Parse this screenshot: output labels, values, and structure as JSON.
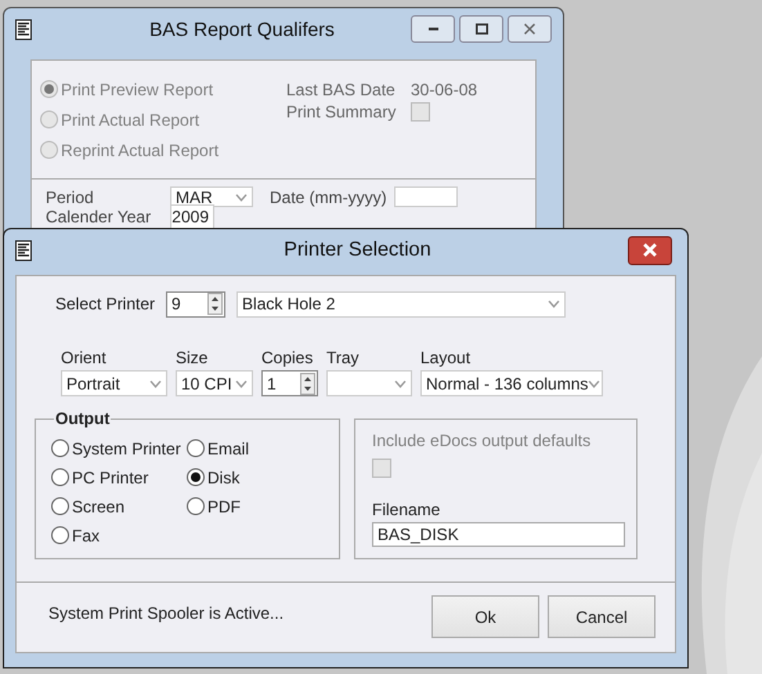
{
  "back_window": {
    "title": "BAS Report Qualifers",
    "report_options": [
      {
        "label": "Print Preview Report",
        "selected": true
      },
      {
        "label": "Print Actual Report",
        "selected": false
      },
      {
        "label": "Reprint Actual Report",
        "selected": false
      }
    ],
    "last_bas_date": {
      "label": "Last BAS Date",
      "value": "30-06-08"
    },
    "print_summary": {
      "label": "Print Summary",
      "checked": false
    },
    "period": {
      "label": "Period",
      "value": "MAR"
    },
    "date": {
      "label": "Date (mm-yyyy)"
    },
    "calendar_year": {
      "label": "Calender Year",
      "value": "2009"
    }
  },
  "dialog": {
    "title": "Printer Selection",
    "select_printer": {
      "label": "Select Printer",
      "number": "9",
      "name": "Black Hole 2"
    },
    "fields": [
      {
        "kind": "combo",
        "label": "Orient",
        "value": "Portrait"
      },
      {
        "kind": "combo",
        "label": "Size",
        "value": "10 CPI"
      },
      {
        "kind": "spin",
        "label": "Copies",
        "value": "1"
      },
      {
        "kind": "combo",
        "label": "Tray"
      },
      {
        "kind": "combo",
        "label": "Layout",
        "value": "Normal - 136 columns"
      }
    ],
    "output": {
      "title": "Output",
      "options": [
        {
          "label": "System Printer",
          "selected": false
        },
        {
          "label": "Email",
          "selected": false
        },
        {
          "label": "PC Printer",
          "selected": false
        },
        {
          "label": "Disk",
          "selected": true
        },
        {
          "label": "Screen",
          "selected": false
        },
        {
          "label": "PDF",
          "selected": false
        },
        {
          "label": "Fax",
          "selected": false
        }
      ]
    },
    "edocs": {
      "label": "Include eDocs output defaults",
      "checked": false
    },
    "filename": {
      "label": "Filename",
      "value": "BAS_DISK"
    },
    "status": "System Print Spooler is Active...",
    "buttons": [
      "Ok",
      "Cancel"
    ]
  }
}
